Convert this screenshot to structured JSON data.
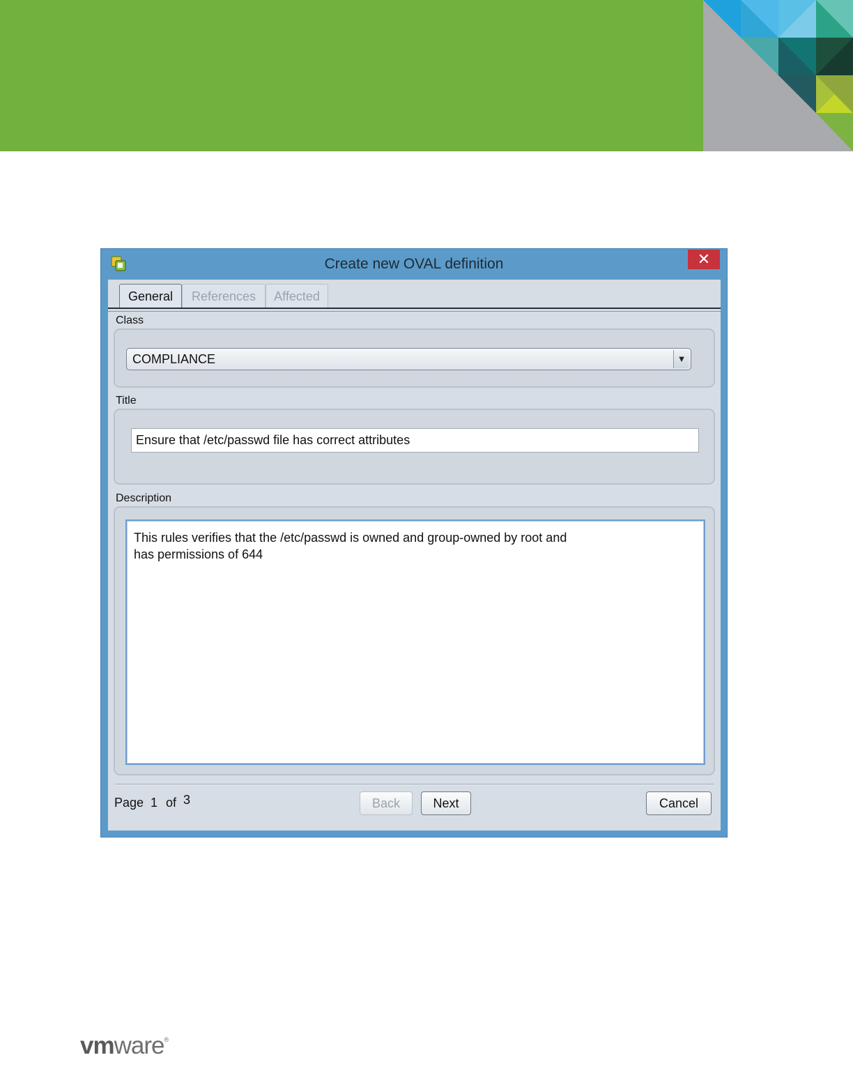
{
  "dialog": {
    "title": "Create new OVAL definition",
    "close_glyph": "✕",
    "tabs": [
      {
        "label": "General",
        "active": true
      },
      {
        "label": "References",
        "active": false
      },
      {
        "label": "Affected",
        "active": false
      }
    ],
    "class": {
      "label": "Class",
      "value": "COMPLIANCE",
      "arrow": "▼"
    },
    "title_field": {
      "label": "Title",
      "value": "Ensure that /etc/passwd file has correct attributes"
    },
    "description": {
      "label": "Description",
      "line1": "This rules verifies that the /etc/passwd is owned and group-owned by root and",
      "line2": "has permissions of 644"
    },
    "footer": {
      "page_word": "Page",
      "current_page": "1",
      "of_word": "of",
      "total_pages": "3",
      "back_label": "Back",
      "next_label": "Next",
      "cancel_label": "Cancel"
    }
  },
  "logo": {
    "vm": "vm",
    "ware": "ware",
    "mark": "®"
  },
  "colors": {
    "banner": "#70b23d",
    "dialog_frame": "#5c9bc9",
    "close": "#c7323c"
  }
}
